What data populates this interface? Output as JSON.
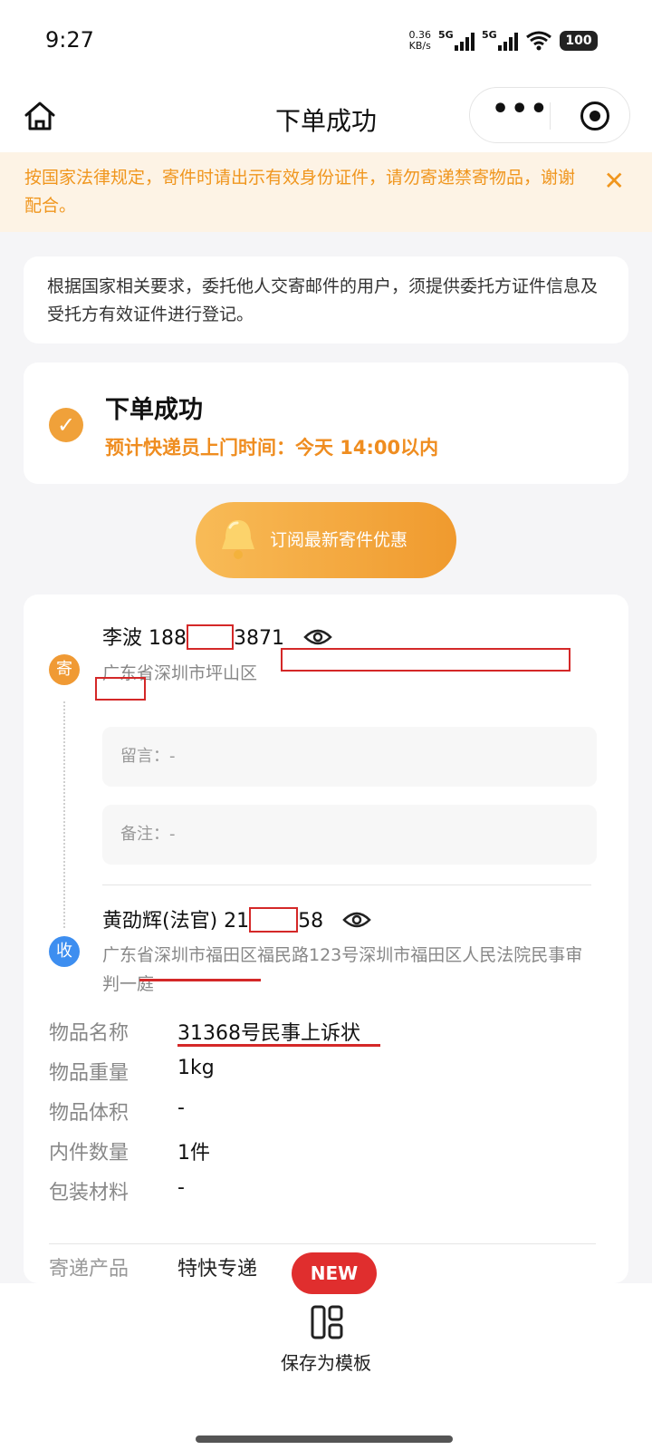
{
  "status_bar": {
    "time": "9:27",
    "net_speed_value": "0.36",
    "net_speed_unit": "KB/s",
    "sim1_label": "5G",
    "sim2_label": "5G",
    "wifi_icon": "wifi-icon",
    "battery": "100"
  },
  "nav": {
    "title": "下单成功",
    "home_icon": "home-icon",
    "more_label": "•••"
  },
  "notice": {
    "text": "按国家法律规定，寄件时请出示有效身份证件，请勿寄递禁寄物品，谢谢配合。",
    "close_label": "✕"
  },
  "info_card": {
    "text": "根据国家相关要求，委托他人交寄邮件的用户，须提供委托方证件信息及受托方有效证件进行登记。"
  },
  "success": {
    "title": "下单成功",
    "pickup_text": "预计快递员上门时间：今天 14:00以内",
    "check_glyph": "✓"
  },
  "subscribe": {
    "label": "订阅最新寄件优惠"
  },
  "sender": {
    "badge": "寄",
    "name": "李波",
    "phone_prefix": "188",
    "phone_suffix": "3871",
    "address": "广东省深圳市坪山区",
    "message_label": "留言：-",
    "remark_label": "备注：-"
  },
  "receiver": {
    "badge": "收",
    "name": "黄劭辉(法官)",
    "phone_prefix": "21",
    "phone_suffix": "58",
    "address": "广东省深圳市福田区福民路123号深圳市福田区人民法院民事审判一庭"
  },
  "details": [
    {
      "label": "物品名称",
      "value": "31368号民事上诉状"
    },
    {
      "label": "物品重量",
      "value": "1kg"
    },
    {
      "label": "物品体积",
      "value": "-"
    },
    {
      "label": "内件数量",
      "value": "1件"
    },
    {
      "label": "包装材料",
      "value": "-"
    }
  ],
  "peek_row": {
    "label": "寄递产品",
    "value": "特快专递"
  },
  "bottom": {
    "new_badge": "NEW",
    "template_label": "保存为模板"
  },
  "colors": {
    "accent_orange": "#f0961e",
    "notice_bg": "#fdf3e5",
    "send_badge": "#f09a34",
    "recv_badge": "#3d8ef0",
    "new_badge": "#e02e2e",
    "annotation_red": "#d42828"
  }
}
